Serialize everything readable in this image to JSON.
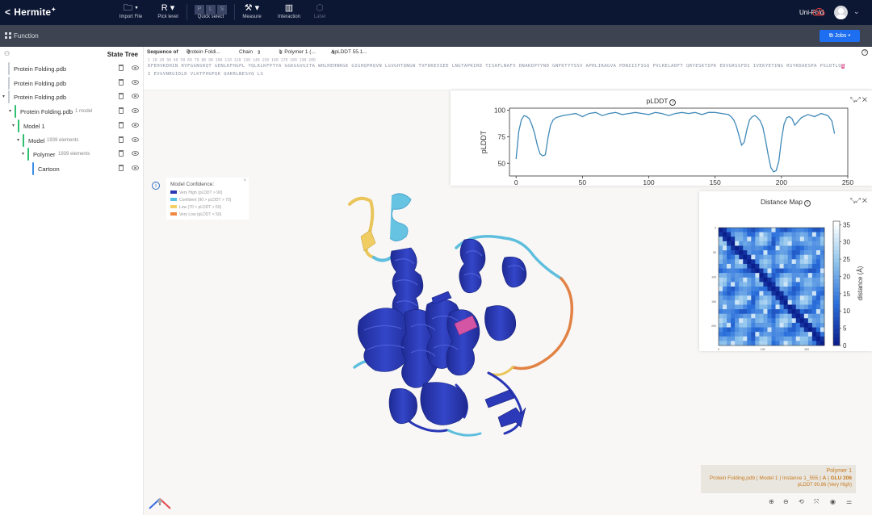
{
  "app": {
    "brand": "Hermite",
    "back": "<",
    "user_label": "Uni-Fold",
    "user_caret": "⌄"
  },
  "toolbar": {
    "import_file": {
      "label": "Import File",
      "glyph": "🗀 ▾"
    },
    "pick_level": {
      "label": "Pick level",
      "glyph": "R ▾"
    },
    "quick_select": {
      "label": "Quick select",
      "letters": [
        "P",
        "L",
        "S"
      ]
    },
    "measure": {
      "label": "Measure",
      "glyph": "⚒ ▾"
    },
    "interaction": {
      "label": "Interaction",
      "glyph": "▥"
    },
    "label": {
      "label": "Label",
      "glyph": "⬡"
    }
  },
  "function_bar": {
    "label": "Function",
    "jobs_button": "Jobs ▾"
  },
  "state_tree": {
    "title": "State Tree",
    "rows": [
      {
        "label": "Protein Folding.pdb",
        "sub": "",
        "bar_color": "#c9cdd3"
      },
      {
        "label": "Protein Folding.pdb",
        "sub": "",
        "bar_color": "#c9cdd3"
      },
      {
        "label": "Protein Folding.pdb",
        "sub": "",
        "bar_color": "#c9cdd3"
      },
      {
        "label": "Protein Folding.pdb",
        "sub": "1 model",
        "bar_color": "#2fbf71"
      },
      {
        "label": "Model 1",
        "sub": "",
        "bar_color": "#2fbf71"
      },
      {
        "label": "Model",
        "sub": "1939 elements",
        "bar_color": "#2fbf71"
      },
      {
        "label": "Polymer",
        "sub": "1939 elements",
        "bar_color": "#2fbf71"
      },
      {
        "label": "Cartoon",
        "sub": "",
        "bar_color": "#3b8ee6"
      }
    ]
  },
  "sequence": {
    "label": "Sequence of",
    "selectors": [
      "Protein Foldi...",
      "Chain",
      "1: Polymer 1 (...",
      "ApLDDT 55.1..."
    ],
    "line1": "DFEHVKDHIN RVFGGNSRQT GENLKFHGPL YQLKLKFPTYA GGKGGVGITA WHLHEHNRGK GIGHQPHQVN LGVGHTQNGN TVFDKEVSEE LNGTAPKIRD TISAFLNAFV DNAKDPYYND GNFKTYTSSV APHLIRAGVA PDNIIIFIGQ PVLRELADFT QRYESKTIPK EDVGRSSFDI IVEKYETING RSYKDAESPA PSLDTLQ",
    "highlight": "S",
    "line2": "I EVGVNRGIDLD VLKTPHGPQK QAKRLNESVQ LS",
    "positions": "1    10        20        30        40        50        60        70        80        90       100       110       120       130       140       150       160       170       180       190       200"
  },
  "legend": {
    "title": "Model Confidence:",
    "close": "×",
    "items": [
      {
        "label": "Very High (pLDDT > 90)",
        "color": "#2a37b5"
      },
      {
        "label": "Confident (90 > pLDDT > 70)",
        "color": "#57c1e0"
      },
      {
        "label": "Low (70 > pLDDT > 50)",
        "color": "#f2d064"
      },
      {
        "label": "Very Low (pLDDT < 50)",
        "color": "#ef8741"
      }
    ]
  },
  "plddt_panel": {
    "title": "pLDDT",
    "controls": "⤡⤢ ✕"
  },
  "distance_panel": {
    "title": "Distance Map",
    "controls": "⤡⤢ ✕"
  },
  "chart_data": [
    {
      "type": "line",
      "title": "pLDDT",
      "ylabel": "pLDDT",
      "xlabel": "",
      "xlim": [
        -5,
        250
      ],
      "ylim": [
        38,
        102
      ],
      "xticks": [
        0,
        50,
        100,
        150,
        200,
        250
      ],
      "yticks": [
        50,
        75,
        100
      ],
      "grid": false,
      "color": "#3f89b8",
      "series": [
        {
          "x": [
            0,
            2,
            4,
            6,
            8,
            10,
            12,
            14,
            16,
            18,
            20,
            22,
            24,
            26,
            28,
            30,
            35,
            40,
            45,
            50,
            55,
            60,
            65,
            70,
            75,
            80,
            85,
            90,
            95,
            100,
            105,
            110,
            115,
            120,
            125,
            130,
            135,
            140,
            145,
            150,
            155,
            160,
            162,
            164,
            166,
            168,
            170,
            172,
            174,
            176,
            178,
            180,
            182,
            184,
            186,
            188,
            190,
            192,
            194,
            196,
            198,
            200,
            202,
            204,
            206,
            208,
            210,
            215,
            220,
            225,
            230,
            235,
            238,
            240
          ],
          "y": [
            54,
            80,
            91,
            95,
            94,
            92,
            86,
            78,
            67,
            59,
            57,
            58,
            74,
            86,
            91,
            93,
            95,
            96,
            97,
            94,
            97,
            98,
            95,
            97,
            98,
            96,
            97,
            98,
            97,
            96,
            98,
            97,
            95,
            97,
            98,
            97,
            98,
            96,
            98,
            98,
            97,
            96,
            94,
            91,
            85,
            76,
            67,
            70,
            82,
            91,
            94,
            95,
            93,
            90,
            84,
            72,
            58,
            46,
            42,
            43,
            52,
            72,
            87,
            93,
            94,
            92,
            86,
            93,
            96,
            94,
            97,
            95,
            90,
            78
          ]
        }
      ]
    },
    {
      "type": "heatmap",
      "title": "Distance Map",
      "colorbar_label": "distance (Å)",
      "colorbar_range": [
        0,
        36
      ],
      "colorbar_ticks": [
        0,
        5,
        10,
        15,
        20,
        25,
        30,
        35
      ],
      "xticks": [
        0,
        100,
        200
      ],
      "yticks": [
        0,
        50,
        100,
        150,
        200
      ],
      "cmap": [
        "#0b1f8c",
        "#2a6fdb",
        "#8ec3ec",
        "#ffffff"
      ]
    }
  ],
  "selection": {
    "title": "Polymer 1",
    "path": "Protein Folding.pdb | Model 1 | Instance 1_555 |",
    "chain": "A",
    "sep": "|",
    "residue": "GLU 206",
    "score": "pLDDT 90.86 (Very High)"
  },
  "bottom_tools": [
    "⊕",
    "⊖",
    "⟲",
    "⤧",
    "◉",
    "⚌"
  ]
}
